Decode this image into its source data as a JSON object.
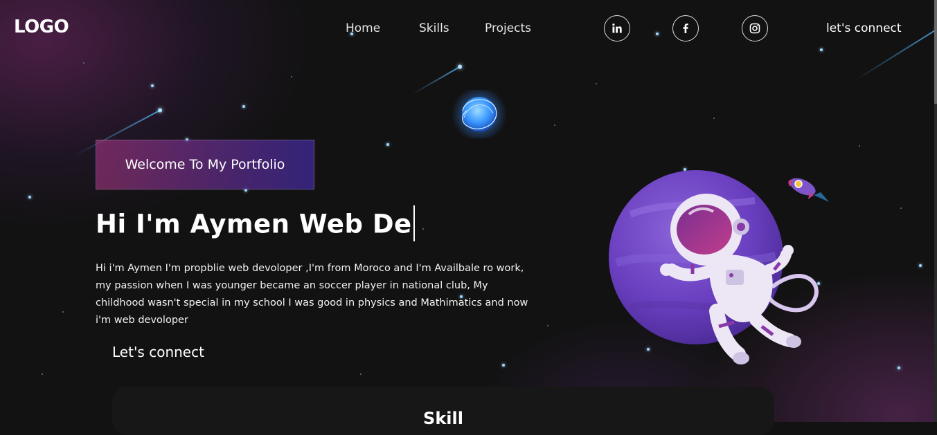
{
  "nav": {
    "logo": "LOGO",
    "links": [
      "Home",
      "Skills",
      "Projects"
    ],
    "social": [
      "linkedin-icon",
      "facebook-icon",
      "instagram-icon"
    ],
    "connect": "let's connect"
  },
  "hero": {
    "tagline": "Welcome To My Portfolio",
    "headline": "Hi I'm Aymen Web De",
    "bio": "Hi i'm Aymen I'm propblie web devoloper ,I'm from Moroco and I'm Availbale ro work, my passion when I was younger became an soccer player in national club, My childhood wasn't special in my school I was good in physics and Mathimatics and now i'm web devoloper",
    "cta": "Let's connect"
  },
  "skills": {
    "title": "Skill"
  },
  "colors": {
    "accent_pink": "#AA367C",
    "accent_purple": "#4A2FBD",
    "background": "#121212"
  }
}
